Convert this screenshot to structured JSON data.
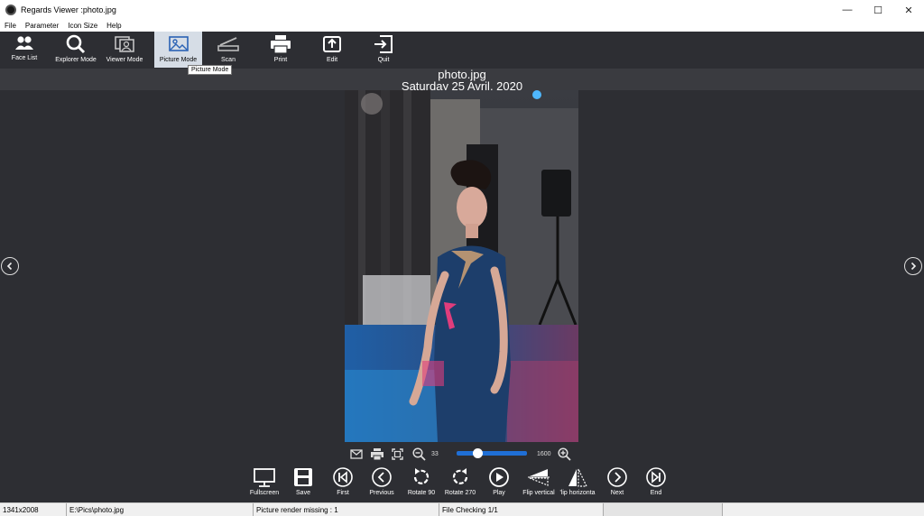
{
  "window": {
    "title": "Regards Viewer :photo.jpg",
    "controls": {
      "minimize": "—",
      "maximize": "☐",
      "close": "✕"
    }
  },
  "menu": [
    "File",
    "Parameter",
    "Icon Size",
    "Help"
  ],
  "toolbar": {
    "items": [
      {
        "label": "Face List",
        "icon": "people-icon"
      },
      {
        "label": "Explorer Mode",
        "icon": "search-icon"
      },
      {
        "label": "Viewer Mode",
        "icon": "viewer-icon"
      },
      {
        "label": "Picture Mode",
        "icon": "picture-icon",
        "active": true
      },
      {
        "label": "Scan",
        "icon": "scanner-icon"
      },
      {
        "label": "Print",
        "icon": "printer-icon"
      },
      {
        "label": "Edit",
        "icon": "edit-icon"
      },
      {
        "label": "Quit",
        "icon": "exit-icon"
      }
    ],
    "tooltip": "Picture Mode"
  },
  "picture": {
    "filename": "photo.jpg",
    "date": "Saturday 25 Avril, 2020"
  },
  "zoom": {
    "min_label": "33",
    "max_label": "1600",
    "level": 0.3
  },
  "controls": [
    {
      "label": "Fullscreen",
      "icon": "monitor-icon"
    },
    {
      "label": "Save",
      "icon": "floppy-icon"
    },
    {
      "label": "First",
      "icon": "first-icon"
    },
    {
      "label": "Previous",
      "icon": "previous-icon"
    },
    {
      "label": "Rotate 90",
      "icon": "rotate-90-icon"
    },
    {
      "label": "Rotate 270",
      "icon": "rotate-270-icon"
    },
    {
      "label": "Play",
      "icon": "play-icon"
    },
    {
      "label": "Flip vertical",
      "icon": "flip-vertical-icon"
    },
    {
      "label": "'lip horizonta",
      "icon": "flip-horizontal-icon"
    },
    {
      "label": "Next",
      "icon": "next-icon"
    },
    {
      "label": "End",
      "icon": "end-icon"
    }
  ],
  "status": {
    "dimensions": "1341x2008",
    "path": "E:\\Pics\\photo.jpg",
    "render": "Picture render missing : 1",
    "checking": "File Checking 1/1"
  },
  "colors": {
    "background": "#2d2e33",
    "active_tool": "#d6dde6",
    "slider": "#1f6fd6"
  }
}
